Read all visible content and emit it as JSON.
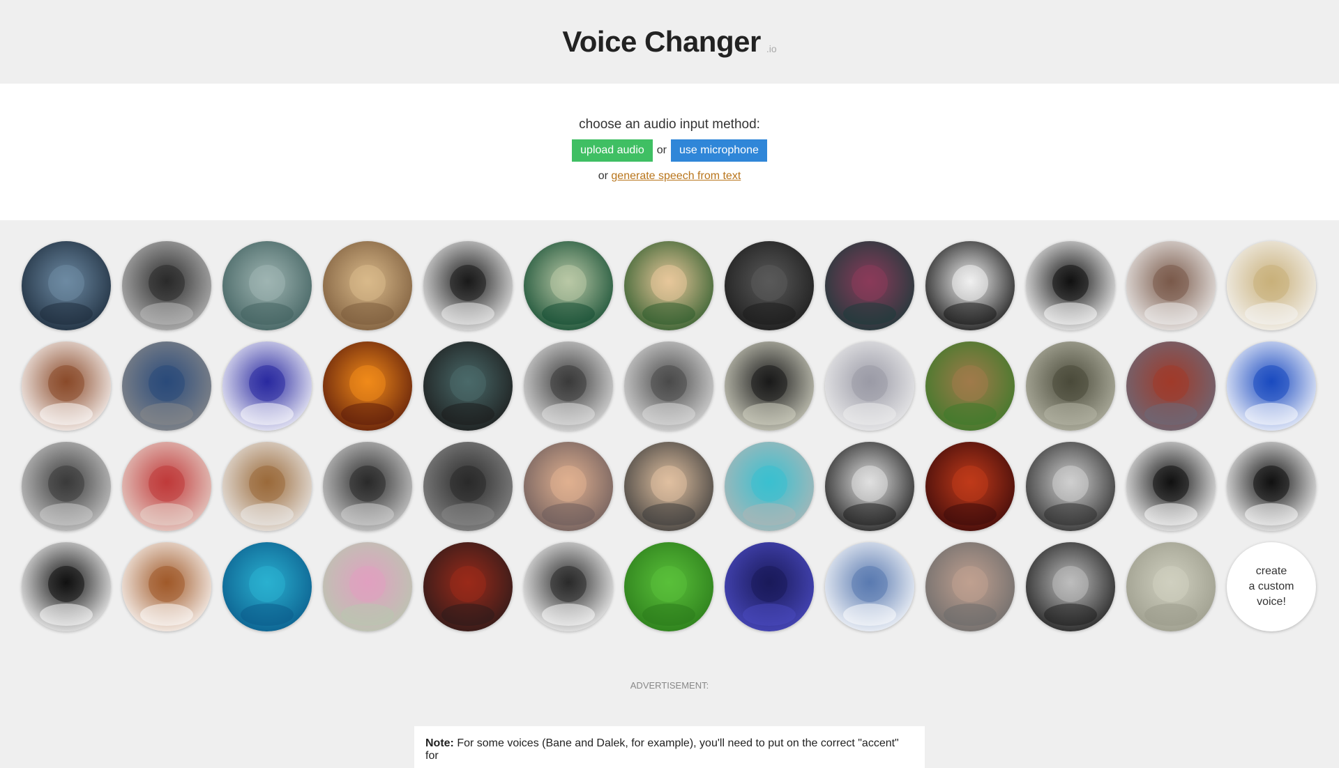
{
  "header": {
    "title": "Voice Changer",
    "suffix": ".io"
  },
  "input": {
    "prompt": "choose an audio input method:",
    "upload_label": "upload audio",
    "or_text": "or",
    "mic_label": "use microphone",
    "alt_prefix": "or",
    "tts_link": "generate speech from text"
  },
  "voices": [
    {
      "name": "monster-voice-icon",
      "colors": [
        "#1b2a3a",
        "#6d8aa3"
      ]
    },
    {
      "name": "radio-speaker-voice-icon",
      "colors": [
        "#bdbdbd",
        "#2a2a2a"
      ]
    },
    {
      "name": "ghost-voice-icon",
      "colors": [
        "#3f5f5e",
        "#9fb5b2"
      ]
    },
    {
      "name": "cathedral-voice-icon",
      "colors": [
        "#7a5a3a",
        "#d9b98a"
      ]
    },
    {
      "name": "telephone-voice-icon",
      "colors": [
        "#f3f3f3",
        "#1a1a1a"
      ]
    },
    {
      "name": "alien-voice-icon",
      "colors": [
        "#0f4a2f",
        "#b9c8a6"
      ]
    },
    {
      "name": "melting-clock-voice-icon",
      "colors": [
        "#2a5a2a",
        "#e7c79a"
      ]
    },
    {
      "name": "dark-alien-voice-icon",
      "colors": [
        "#1a1a1a",
        "#5a5a5a"
      ]
    },
    {
      "name": "cyborg-voice-icon",
      "colors": [
        "#1a3a3a",
        "#8a3a5a"
      ]
    },
    {
      "name": "anonymous-mask-voice-icon",
      "colors": [
        "#111111",
        "#f0f0f0"
      ]
    },
    {
      "name": "reversed-clock-voice-icon",
      "colors": [
        "#ffffff",
        "#111111"
      ]
    },
    {
      "name": "old-radio-voice-icon",
      "colors": [
        "#f2f2f2",
        "#7a5a4a"
      ]
    },
    {
      "name": "cymbal-voice-icon",
      "colors": [
        "#f6f6f6",
        "#c9b07a"
      ]
    },
    {
      "name": "dalek-voice-icon",
      "colors": [
        "#ffffff",
        "#8a4a2a"
      ]
    },
    {
      "name": "guitar-pedal-voice-icon",
      "colors": [
        "#8a8a8a",
        "#2a4a7a"
      ]
    },
    {
      "name": "sine-wave-voice-icon",
      "colors": [
        "#ffffff",
        "#2a2aa0"
      ]
    },
    {
      "name": "balrog-voice-icon",
      "colors": [
        "#5a1a0a",
        "#f08a1a"
      ]
    },
    {
      "name": "cave-voice-icon",
      "colors": [
        "#1a1a1a",
        "#4a6a6a"
      ]
    },
    {
      "name": "white-robot-voice-icon",
      "colors": [
        "#e6e6e6",
        "#3a3a3a"
      ]
    },
    {
      "name": "white-robot-2-voice-icon",
      "colors": [
        "#e0e0e0",
        "#4a4a4a"
      ]
    },
    {
      "name": "toy-robot-voice-icon",
      "colors": [
        "#d6d6c6",
        "#1a1a1a"
      ]
    },
    {
      "name": "lego-robot-voice-icon",
      "colors": [
        "#f0f0f0",
        "#9a9aa6"
      ]
    },
    {
      "name": "snail-voice-icon",
      "colors": [
        "#3a7a2a",
        "#a07a4a"
      ]
    },
    {
      "name": "tortoise-voice-icon",
      "colors": [
        "#b8b8a8",
        "#4a4a3a"
      ]
    },
    {
      "name": "sprinter-voice-icon",
      "colors": [
        "#6a6a7a",
        "#a03a2a"
      ]
    },
    {
      "name": "sonic-voice-icon",
      "colors": [
        "#ffffff",
        "#1a4ac0"
      ]
    },
    {
      "name": "soldier-radio-voice-icon",
      "colors": [
        "#cfcfcf",
        "#3a3a3a"
      ]
    },
    {
      "name": "playing-cards-voice-icon",
      "colors": [
        "#e8d8d0",
        "#c03a3a"
      ]
    },
    {
      "name": "wooden-speaker-voice-icon",
      "colors": [
        "#eeeeee",
        "#9a6a3a"
      ]
    },
    {
      "name": "bell-telephone-voice-icon",
      "colors": [
        "#d6d6d6",
        "#2a2a2a"
      ]
    },
    {
      "name": "sauron-voice-icon",
      "colors": [
        "#8a8a8a",
        "#2a2a2a"
      ]
    },
    {
      "name": "russian-voice-icon",
      "colors": [
        "#6a5a5a",
        "#e0b090"
      ]
    },
    {
      "name": "jackie-chan-voice-icon",
      "colors": [
        "#3a3a3a",
        "#e0c0a0"
      ]
    },
    {
      "name": "grey-robot-voice-icon",
      "colors": [
        "#b0b6b6",
        "#3ac0d0"
      ]
    },
    {
      "name": "kirobo-robot-voice-icon",
      "colors": [
        "#1a1a1a",
        "#e0e0e0"
      ]
    },
    {
      "name": "demon-voice-icon",
      "colors": [
        "#3a0a0a",
        "#c03a1a"
      ]
    },
    {
      "name": "astronaut-voice-icon",
      "colors": [
        "#2a2a2a",
        "#cfcfcf"
      ]
    },
    {
      "name": "down-arrows-voice-icon",
      "colors": [
        "#ffffff",
        "#111111"
      ]
    },
    {
      "name": "many-down-arrows-voice-icon",
      "colors": [
        "#ffffff",
        "#111111"
      ]
    },
    {
      "name": "up-arrows-voice-icon",
      "colors": [
        "#ffffff",
        "#111111"
      ]
    },
    {
      "name": "chipmunk-voice-icon",
      "colors": [
        "#ffffff",
        "#a05a2a"
      ]
    },
    {
      "name": "diver-voice-icon",
      "colors": [
        "#0a5a8a",
        "#2ab0d0"
      ]
    },
    {
      "name": "retro-computer-voice-icon",
      "colors": [
        "#b8c8b0",
        "#e0a0c0"
      ]
    },
    {
      "name": "red-robot-voice-icon",
      "colors": [
        "#2a1a1a",
        "#9a2a1a"
      ]
    },
    {
      "name": "coiled-cable-voice-icon",
      "colors": [
        "#ffffff",
        "#2a2a2a"
      ]
    },
    {
      "name": "mosquito-voice-icon",
      "colors": [
        "#2a7a1a",
        "#5ac03a"
      ]
    },
    {
      "name": "transformer-voice-icon",
      "colors": [
        "#4a4ac0",
        "#1a1a5a"
      ]
    },
    {
      "name": "megaphone-voice-icon",
      "colors": [
        "#ffffff",
        "#5a7ab0"
      ]
    },
    {
      "name": "bane-voice-icon",
      "colors": [
        "#6a6a6a",
        "#c0a090"
      ]
    },
    {
      "name": "microphone-voice-icon",
      "colors": [
        "#1a1a1a",
        "#bdbdbd"
      ]
    },
    {
      "name": "tuning-knob-voice-icon",
      "colors": [
        "#9a9a8a",
        "#d0d0c0"
      ]
    }
  ],
  "custom_voice": {
    "label": "create\na custom\nvoice!"
  },
  "ad_label": "ADVERTISEMENT:",
  "note": {
    "bold": "Note:",
    "text": " For some voices (Bane and Dalek, for example), you'll need to put on the correct \"accent\" for"
  }
}
